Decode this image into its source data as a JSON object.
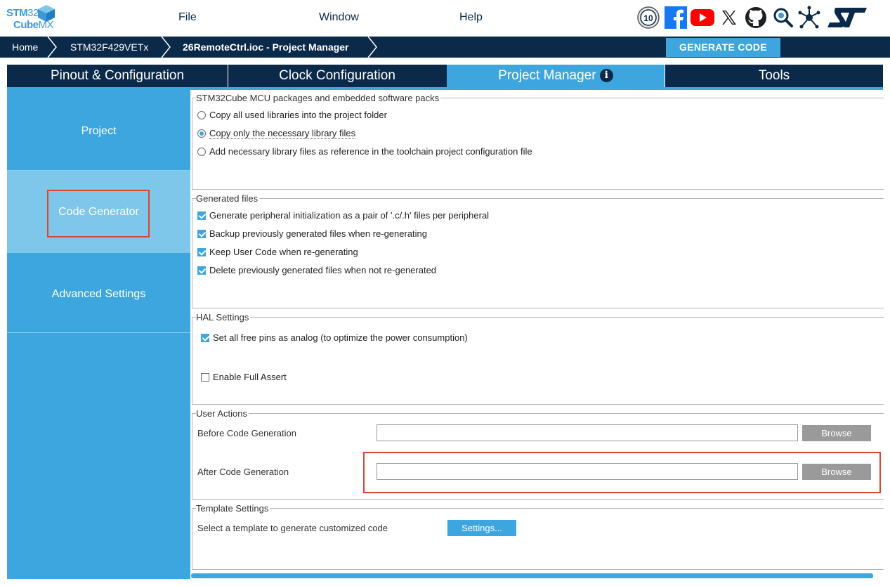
{
  "app": {
    "logo_line1_bold": "STM",
    "logo_line1_light": "32",
    "logo_line2_bold": "Cube",
    "logo_line2_light": "MX"
  },
  "menu": {
    "file": "File",
    "window": "Window",
    "help": "Help"
  },
  "social_icons": [
    "anniversary-10-icon",
    "facebook-icon",
    "youtube-icon",
    "x-twitter-icon",
    "github-icon",
    "community-search-icon",
    "network-icon",
    "st-logo-icon"
  ],
  "breadcrumb": {
    "home": "Home",
    "mcu": "STM32F429VETx",
    "project": "26RemoteCtrl.ioc - Project Manager"
  },
  "generate_button": "GENERATE CODE",
  "tabs": [
    {
      "label": "Pinout & Configuration"
    },
    {
      "label": "Clock Configuration"
    },
    {
      "label": "Project Manager",
      "active": true
    },
    {
      "label": "Tools"
    }
  ],
  "sidebar": {
    "items": [
      {
        "label": "Project"
      },
      {
        "label": "Code Generator",
        "active": true
      },
      {
        "label": "Advanced Settings"
      }
    ]
  },
  "packages": {
    "title": "STM32Cube MCU packages and embedded software packs",
    "options": [
      {
        "label": "Copy all used libraries into the project folder",
        "selected": false
      },
      {
        "label": "Copy only the necessary library files",
        "selected": true
      },
      {
        "label": "Add necessary library files as reference in the toolchain project configuration file",
        "selected": false
      }
    ]
  },
  "generated_files": {
    "title": "Generated files",
    "options": [
      {
        "label": "Generate peripheral initialization as a pair of '.c/.h' files per peripheral",
        "checked": true
      },
      {
        "label": "Backup previously generated files when re-generating",
        "checked": true
      },
      {
        "label": "Keep User Code when re-generating",
        "checked": true
      },
      {
        "label": "Delete previously generated files when not re-generated",
        "checked": true
      }
    ]
  },
  "hal_settings": {
    "title": "HAL Settings",
    "options": [
      {
        "label": "Set all free pins as analog (to optimize the power consumption)",
        "checked": true
      },
      {
        "label": "Enable Full Assert",
        "checked": false
      }
    ]
  },
  "user_actions": {
    "title": "User Actions",
    "before_label": "Before Code Generation",
    "before_value": "",
    "after_label": "After Code Generation",
    "after_value": "",
    "browse_label": "Browse"
  },
  "template_settings": {
    "title": "Template Settings",
    "label": "Select a template to generate customized code",
    "button": "Settings..."
  },
  "colors": {
    "navy": "#0b2a4a",
    "accent": "#3ea6df",
    "sidebar_active": "#7ec6ea",
    "highlight": "#d9462f"
  }
}
